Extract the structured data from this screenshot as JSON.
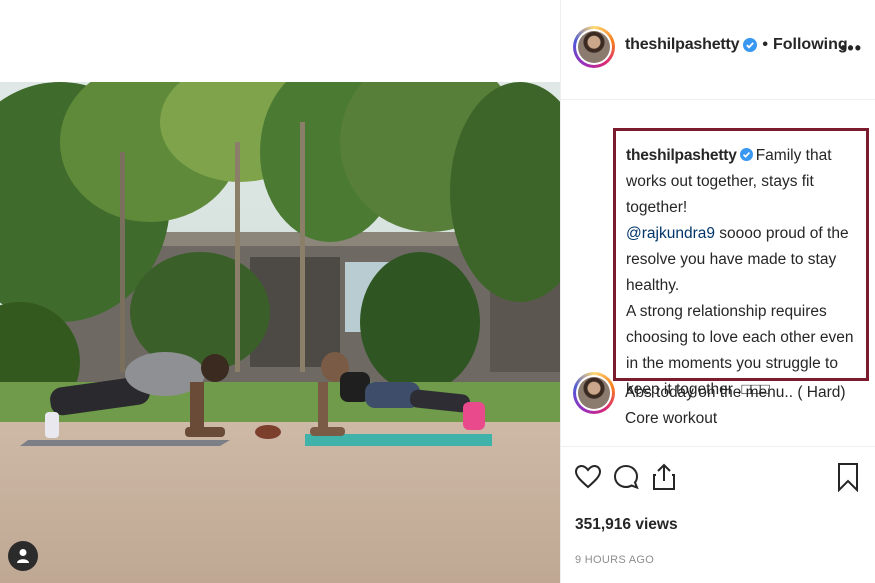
{
  "post": {
    "username": "theshilpashetty",
    "dot": "•",
    "follow_status": "Following",
    "more_label": "•••"
  },
  "caption": {
    "username": "theshilpashetty",
    "text_1": "Family that works out together, stays fit together!",
    "mention": "@rajkundra9",
    "text_2": "soooo proud of the resolve you have made to stay healthy.",
    "text_3": "A strong relationship requires choosing to love each other even in the moments you struggle to keep it together .",
    "emoji_placeholder": "□□□"
  },
  "comment": {
    "text": "Abs today on the menu.. ( Hard) Core workout"
  },
  "stats": {
    "views": "351,916 views",
    "time": "9 HOURS AGO"
  },
  "icons": {
    "like": "heart-icon",
    "comment": "comment-icon",
    "share": "share-icon",
    "save": "bookmark-icon",
    "verified": "verified-badge-icon",
    "user_tag": "user-tag-icon"
  },
  "colors": {
    "highlight_border": "#7a1c2e",
    "verified_blue": "#3897f0",
    "mention": "#003569",
    "muted": "#8e8e8e"
  }
}
